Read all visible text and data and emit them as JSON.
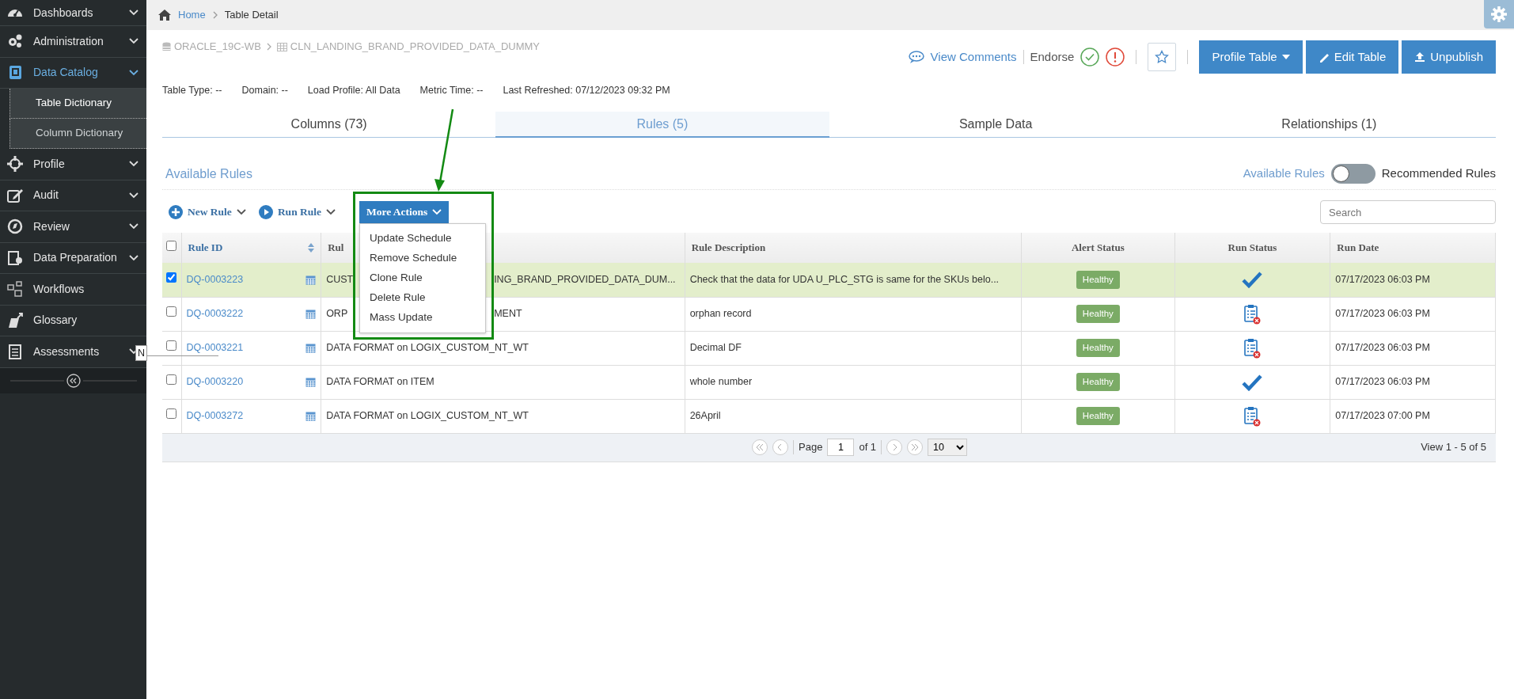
{
  "sidebar": {
    "items": [
      {
        "label": "Dashboards",
        "chevron": true,
        "expanded": false
      },
      {
        "label": "Administration",
        "chevron": true,
        "expanded": false
      },
      {
        "label": "Data Catalog",
        "chevron": true,
        "expanded": true,
        "children": [
          {
            "label": "Table Dictionary",
            "selected": true
          },
          {
            "label": "Column Dictionary",
            "selected": false
          }
        ]
      },
      {
        "label": "Profile",
        "chevron": true,
        "expanded": false
      },
      {
        "label": "Audit",
        "chevron": true,
        "expanded": false
      },
      {
        "label": "Review",
        "chevron": true,
        "expanded": false
      },
      {
        "label": "Data Preparation",
        "chevron": true,
        "expanded": false
      },
      {
        "label": "Workflows",
        "chevron": false,
        "expanded": false
      },
      {
        "label": "Glossary",
        "chevron": false,
        "expanded": false
      },
      {
        "label": "Assessments",
        "chevron": true,
        "expanded": false
      }
    ]
  },
  "tooltip": {
    "text": "N"
  },
  "breadcrumb": [
    "Home",
    "Table Detail"
  ],
  "object_path": [
    "ORACLE_19C-WB",
    "CLN_LANDING_BRAND_PROVIDED_DATA_DUMMY"
  ],
  "header_actions": {
    "view_comments": "View Comments",
    "endorse": "Endorse",
    "buttons": [
      {
        "label": "Profile Table",
        "dropdown": true
      },
      {
        "label": "Edit Table",
        "dropdown": false
      },
      {
        "label": "Unpublish",
        "dropdown": false
      }
    ]
  },
  "meta": [
    "Table Type: --",
    "Domain: --",
    "Load Profile: All Data",
    "Metric Time: --",
    "Last Refreshed: 07/12/2023 09:32 PM"
  ],
  "tabs": [
    {
      "label": "Columns (73)",
      "selected": false
    },
    {
      "label": "Rules (5)",
      "selected": true
    },
    {
      "label": "Sample Data",
      "selected": false
    },
    {
      "label": "Relationships (1)",
      "selected": false
    }
  ],
  "section_title": "Available Rules",
  "toggle": {
    "left_label": "Available Rules",
    "right_label": "Recommended Rules",
    "on": false
  },
  "toolbar": {
    "new_rule": "New Rule",
    "run_rule": "Run Rule",
    "more_actions": "More Actions"
  },
  "more_actions_menu": [
    "Update Schedule",
    "Remove Schedule",
    "Clone Rule",
    "Delete Rule",
    "Mass Update"
  ],
  "search": {
    "placeholder": "Search"
  },
  "table": {
    "all_checked": false,
    "columns": [
      "Rule ID",
      "Rul",
      "Rule Description",
      "Alert Status",
      "Run Status",
      "Run Date"
    ],
    "rows": [
      {
        "checked": true,
        "selected": true,
        "id": "DQ-0003223",
        "name_parts": [
          "CUST",
          "ING_BRAND_PROVIDED_DATA_DUM..."
        ],
        "description": "Check that the data for UDA U_PLC_STG is same for the SKUs belo...",
        "alert": "Healthy",
        "run_ok": true,
        "run_date": "07/17/2023 06:03 PM"
      },
      {
        "checked": false,
        "selected": false,
        "id": "DQ-0003222",
        "name_parts": [
          "ORP",
          "MENT"
        ],
        "description": "orphan record",
        "alert": "Healthy",
        "run_ok": false,
        "run_date": "07/17/2023 06:03 PM"
      },
      {
        "checked": false,
        "selected": false,
        "id": "DQ-0003221",
        "name_parts": [
          "DATA FORMAT on LOGIX_CUSTOM_NT_WT"
        ],
        "description": "Decimal DF",
        "alert": "Healthy",
        "run_ok": false,
        "run_date": "07/17/2023 06:03 PM"
      },
      {
        "checked": false,
        "selected": false,
        "id": "DQ-0003220",
        "name_parts": [
          "DATA FORMAT on ITEM"
        ],
        "description": "whole number",
        "alert": "Healthy",
        "run_ok": true,
        "run_date": "07/17/2023 06:03 PM"
      },
      {
        "checked": false,
        "selected": false,
        "id": "DQ-0003272",
        "name_parts": [
          "DATA FORMAT on LOGIX_CUSTOM_NT_WT"
        ],
        "description": "26April",
        "alert": "Healthy",
        "run_ok": false,
        "run_date": "07/17/2023 07:00 PM"
      }
    ]
  },
  "pager": {
    "page_label": "Page",
    "page": "1",
    "of": "of 1",
    "page_size": "10",
    "summary": "View 1 - 5 of 5"
  }
}
